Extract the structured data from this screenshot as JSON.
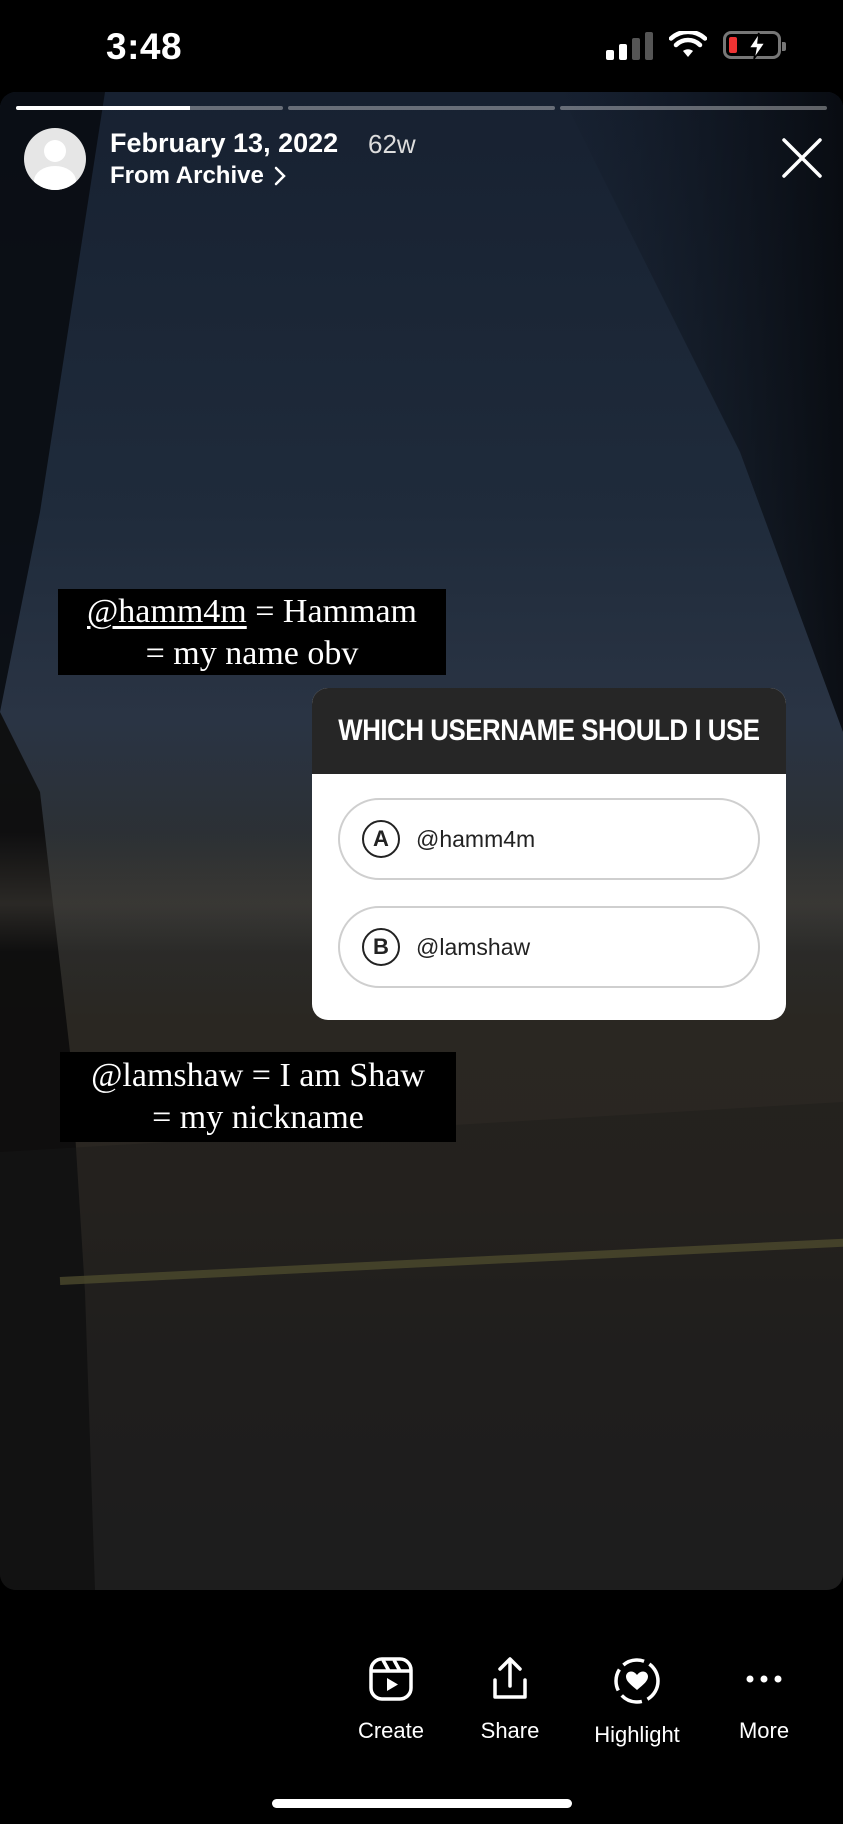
{
  "status_bar": {
    "time": "3:48",
    "battery_state": "charging-low"
  },
  "story": {
    "progress_segments": [
      0.65,
      0,
      0
    ],
    "date": "February 13, 2022",
    "age": "62w",
    "source_link": "From Archive",
    "captions": [
      {
        "username": "@hamm4m",
        "line1_rest": " = Hammam",
        "line2": "= my name obv"
      },
      {
        "line1": "@lamshaw = I am Shaw",
        "line2": "= my nickname"
      }
    ],
    "poll": {
      "question": "WHICH USERNAME SHOULD I USE",
      "options": [
        {
          "letter": "A",
          "label": "@hamm4m"
        },
        {
          "letter": "B",
          "label": "@lamshaw"
        }
      ]
    }
  },
  "toolbar": {
    "create": "Create",
    "share": "Share",
    "highlight": "Highlight",
    "more": "More"
  },
  "colors": {
    "poll_header": "#262626",
    "battery_low": "#ee3333"
  }
}
